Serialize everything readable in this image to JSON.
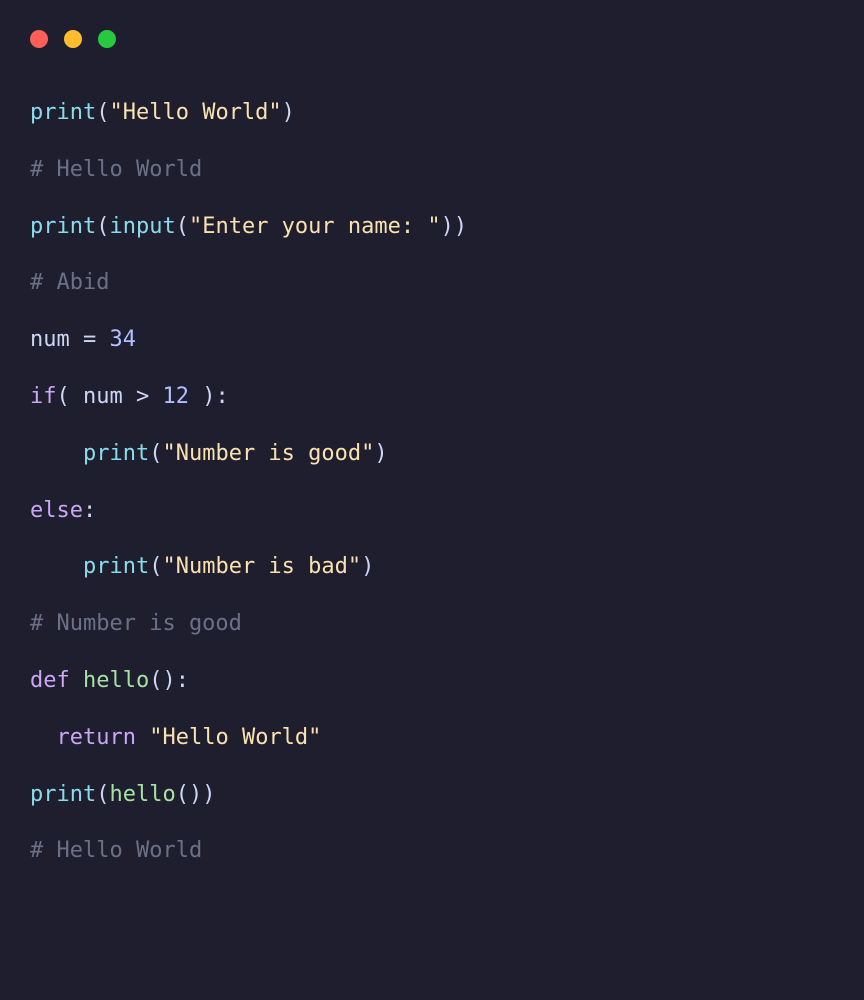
{
  "code": {
    "lines": [
      {
        "type": "code",
        "tokens": [
          {
            "cls": "fn",
            "t": "print"
          },
          {
            "cls": "punc",
            "t": "("
          },
          {
            "cls": "str",
            "t": "\"Hello World\""
          },
          {
            "cls": "punc",
            "t": ")"
          }
        ],
        "indent": 0
      },
      {
        "type": "comment",
        "text": "# Hello World",
        "indent": 0
      },
      {
        "type": "code",
        "tokens": [
          {
            "cls": "fn",
            "t": "print"
          },
          {
            "cls": "punc",
            "t": "("
          },
          {
            "cls": "fn",
            "t": "input"
          },
          {
            "cls": "punc",
            "t": "("
          },
          {
            "cls": "str",
            "t": "\"Enter your name: \""
          },
          {
            "cls": "punc",
            "t": "))"
          }
        ],
        "indent": 0
      },
      {
        "type": "comment",
        "text": "# Abid",
        "indent": 0
      },
      {
        "type": "code",
        "tokens": [
          {
            "cls": "ident",
            "t": "num"
          },
          {
            "cls": "op",
            "t": " = "
          },
          {
            "cls": "num",
            "t": "34"
          }
        ],
        "indent": 0
      },
      {
        "type": "code",
        "tokens": [
          {
            "cls": "kw",
            "t": "if"
          },
          {
            "cls": "punc",
            "t": "( "
          },
          {
            "cls": "ident",
            "t": "num"
          },
          {
            "cls": "op",
            "t": " > "
          },
          {
            "cls": "num",
            "t": "12"
          },
          {
            "cls": "punc",
            "t": " ):"
          }
        ],
        "indent": 0
      },
      {
        "type": "code",
        "tokens": [
          {
            "cls": "fn",
            "t": "print"
          },
          {
            "cls": "punc",
            "t": "("
          },
          {
            "cls": "str",
            "t": "\"Number is good\""
          },
          {
            "cls": "punc",
            "t": ")"
          }
        ],
        "indent": 4
      },
      {
        "type": "code",
        "tokens": [
          {
            "cls": "kw",
            "t": "else"
          },
          {
            "cls": "punc",
            "t": ":"
          }
        ],
        "indent": 0
      },
      {
        "type": "code",
        "tokens": [
          {
            "cls": "fn",
            "t": "print"
          },
          {
            "cls": "punc",
            "t": "("
          },
          {
            "cls": "str",
            "t": "\"Number is bad\""
          },
          {
            "cls": "punc",
            "t": ")"
          }
        ],
        "indent": 4
      },
      {
        "type": "comment",
        "text": "# Number is good",
        "indent": 0
      },
      {
        "type": "code",
        "tokens": [
          {
            "cls": "kw",
            "t": "def"
          },
          {
            "cls": "punc",
            "t": " "
          },
          {
            "cls": "def-name",
            "t": "hello"
          },
          {
            "cls": "punc",
            "t": "():"
          }
        ],
        "indent": 0
      },
      {
        "type": "code",
        "tokens": [
          {
            "cls": "kw",
            "t": "return"
          },
          {
            "cls": "punc",
            "t": " "
          },
          {
            "cls": "str",
            "t": "\"Hello World\""
          }
        ],
        "indent": 2
      },
      {
        "type": "code",
        "tokens": [
          {
            "cls": "fn",
            "t": "print"
          },
          {
            "cls": "punc",
            "t": "("
          },
          {
            "cls": "call-name",
            "t": "hello"
          },
          {
            "cls": "punc",
            "t": "())"
          }
        ],
        "indent": 0
      },
      {
        "type": "comment",
        "text": "# Hello World",
        "indent": 0
      }
    ]
  },
  "window": {
    "dots": [
      "red",
      "yellow",
      "green"
    ]
  }
}
